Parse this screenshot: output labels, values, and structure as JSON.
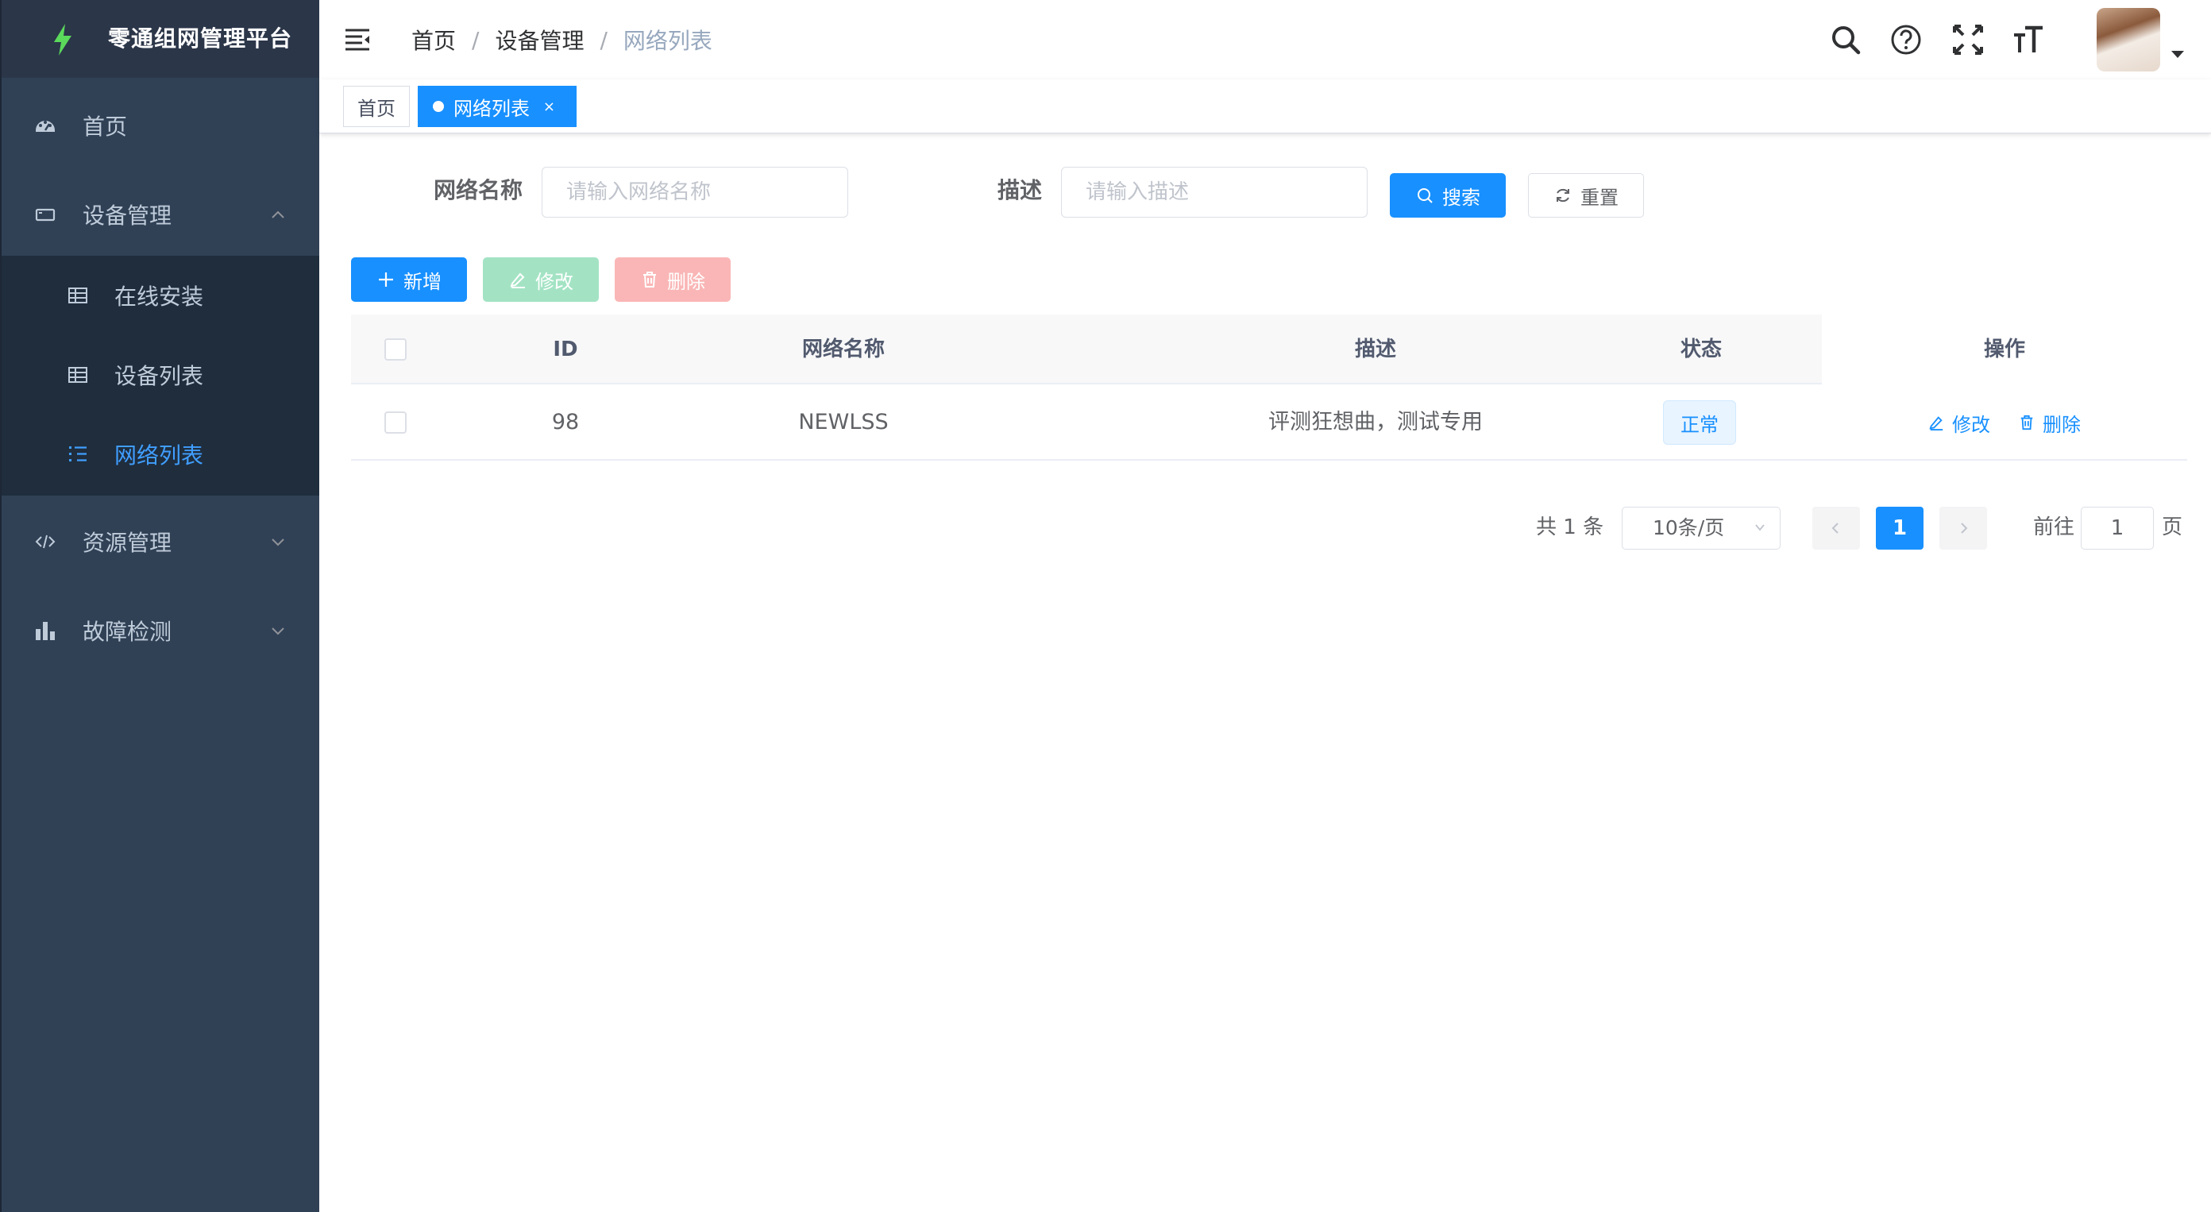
{
  "app": {
    "title": "零通组网管理平台"
  },
  "sidebar": {
    "items": [
      {
        "label": "首页",
        "icon": "dashboard-icon"
      },
      {
        "label": "设备管理",
        "icon": "monitor-icon",
        "expanded": true
      },
      {
        "label": "资源管理",
        "icon": "code-icon"
      },
      {
        "label": "故障检测",
        "icon": "bar-chart-icon"
      }
    ],
    "subitems": [
      {
        "label": "在线安装",
        "icon": "table-icon"
      },
      {
        "label": "设备列表",
        "icon": "table-icon"
      },
      {
        "label": "网络列表",
        "icon": "list-icon",
        "active": true
      }
    ]
  },
  "header": {
    "breadcrumb": [
      "首页",
      "设备管理",
      "网络列表"
    ],
    "tools": [
      "search-icon",
      "help-icon",
      "fullscreen-icon",
      "font-size-icon"
    ]
  },
  "tags": {
    "home": "首页",
    "active": "网络列表",
    "close": "×"
  },
  "search": {
    "name_label": "网络名称",
    "name_placeholder": "请输入网络名称",
    "desc_label": "描述",
    "desc_placeholder": "请输入描述",
    "search_btn": "搜索",
    "reset_btn": "重置"
  },
  "toolbar": {
    "add": "新增",
    "edit": "修改",
    "delete": "删除"
  },
  "table": {
    "columns": [
      "ID",
      "网络名称",
      "描述",
      "状态",
      "操作"
    ],
    "rows": [
      {
        "id": "98",
        "name": "NEWLSS",
        "desc": "评测狂想曲，测试专用",
        "status": "正常",
        "edit": "修改",
        "delete": "删除"
      }
    ]
  },
  "pagination": {
    "total": "共 1 条",
    "page_size": "10条/页",
    "current": "1",
    "goto_label": "前往",
    "goto_value": "1",
    "page_suffix": "页"
  },
  "colors": {
    "primary": "#1890ff",
    "sidebar_bg": "#304156",
    "submenu_bg": "#1f2d3d",
    "active_text": "#409eff",
    "logo_bolt": "#5bd95b"
  }
}
